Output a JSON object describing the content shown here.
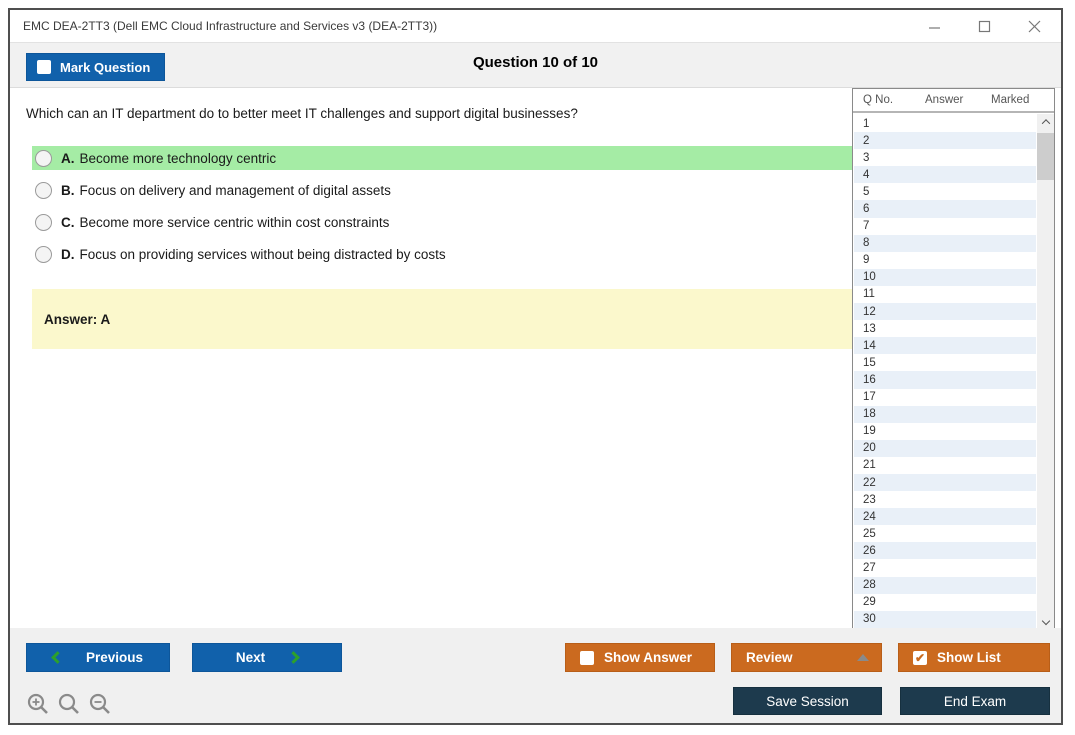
{
  "window": {
    "title": "EMC DEA-2TT3 (Dell EMC Cloud Infrastructure and Services v3 (DEA-2TT3))"
  },
  "header": {
    "mark_question_label": "Mark Question",
    "question_counter": "Question 10 of 10"
  },
  "question": {
    "text": "Which can an IT department do to better meet IT challenges and support digital businesses?",
    "options": [
      {
        "letter": "A.",
        "text": "Become more technology centric",
        "highlighted": true
      },
      {
        "letter": "B.",
        "text": "Focus on delivery and management of digital assets",
        "highlighted": false
      },
      {
        "letter": "C.",
        "text": "Become more service centric within cost constraints",
        "highlighted": false
      },
      {
        "letter": "D.",
        "text": "Focus on providing services without being distracted by costs",
        "highlighted": false
      }
    ],
    "answer_label": "Answer: A"
  },
  "question_list": {
    "columns": {
      "qno": "Q No.",
      "answer": "Answer",
      "marked": "Marked"
    },
    "rows": [
      "1",
      "2",
      "3",
      "4",
      "5",
      "6",
      "7",
      "8",
      "9",
      "10",
      "11",
      "12",
      "13",
      "14",
      "15",
      "16",
      "17",
      "18",
      "19",
      "20",
      "21",
      "22",
      "23",
      "24",
      "25",
      "26",
      "27",
      "28",
      "29",
      "30"
    ]
  },
  "footer": {
    "previous_label": "Previous",
    "next_label": "Next",
    "show_answer_label": "Show Answer",
    "review_label": "Review",
    "show_list_label": "Show List",
    "save_session_label": "Save Session",
    "end_exam_label": "End Exam",
    "show_list_check": "✔"
  },
  "colors": {
    "accent_blue": "#1161ab",
    "accent_orange": "#cb6a1f",
    "accent_navy": "#1d3a4d",
    "highlight_green": "#a5eca5",
    "answer_yellow": "#fbf8cc",
    "row_alt_blue": "#e9f0f8",
    "chevron_green": "#2ca02c"
  }
}
